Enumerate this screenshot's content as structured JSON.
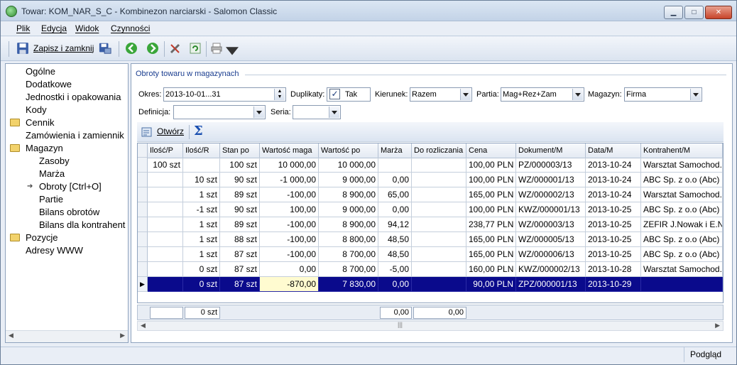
{
  "window": {
    "title": "Towar: KOM_NAR_S_C - Kombinezon narciarski - Salomon Classic"
  },
  "menu": {
    "items": [
      "Plik",
      "Edycja",
      "Widok",
      "Czynności"
    ]
  },
  "toolbar": {
    "save_close_label": "Zapisz i zamknij"
  },
  "sidebar": {
    "items": [
      {
        "label": "Ogólne",
        "level": 0,
        "folder": false
      },
      {
        "label": "Dodatkowe",
        "level": 0,
        "folder": false
      },
      {
        "label": "Jednostki i opakowania",
        "level": 0,
        "folder": false
      },
      {
        "label": "Kody",
        "level": 0,
        "folder": false
      },
      {
        "label": "Cennik",
        "level": 0,
        "folder": true
      },
      {
        "label": "Zamówienia i zamiennik",
        "level": 0,
        "folder": false
      },
      {
        "label": "Magazyn",
        "level": 0,
        "folder": true
      },
      {
        "label": "Zasoby",
        "level": 1,
        "folder": false
      },
      {
        "label": "Marża",
        "level": 1,
        "folder": false
      },
      {
        "label": "Obroty [Ctrl+O]",
        "level": 1,
        "folder": false,
        "active": true
      },
      {
        "label": "Partie",
        "level": 1,
        "folder": false
      },
      {
        "label": "Bilans obrotów",
        "level": 1,
        "folder": false
      },
      {
        "label": "Bilans dla kontrahent",
        "level": 1,
        "folder": false
      },
      {
        "label": "Pozycje",
        "level": 0,
        "folder": true
      },
      {
        "label": "Adresy WWW",
        "level": 0,
        "folder": false
      }
    ]
  },
  "filters": {
    "group_title": "Obroty towaru w magazynach",
    "okres_label": "Okres:",
    "okres_value": "2013-10-01...31",
    "duplikaty_label": "Duplikaty:",
    "duplikaty_value": "Tak",
    "kierunek_label": "Kierunek:",
    "kierunek_value": "Razem",
    "partia_label": "Partia:",
    "partia_value": "Mag+Rez+Zam",
    "magazyn_label": "Magazyn:",
    "magazyn_value": "Firma",
    "definicja_label": "Definicja:",
    "definicja_value": "",
    "seria_label": "Seria:",
    "seria_value": ""
  },
  "grid": {
    "open_label": "Otwórz",
    "columns": [
      "Ilość/P",
      "Ilość/R",
      "Stan po",
      "Wartość maga",
      "Wartość po",
      "Marża",
      "Do rozliczania",
      "Cena",
      "Dokument/M",
      "Data/M",
      "Kontrahent/M"
    ],
    "rows": [
      [
        "100 szt",
        "",
        "100 szt",
        "10 000,00",
        "10 000,00",
        "",
        "",
        "100,00 PLN",
        "PZ/000003/13",
        "2013-10-24",
        "Warsztat Samochod."
      ],
      [
        "",
        "10 szt",
        "90 szt",
        "-1 000,00",
        "9 000,00",
        "0,00",
        "",
        "100,00 PLN",
        "WZ/000001/13",
        "2013-10-24",
        "ABC Sp. z o.o (Abc)"
      ],
      [
        "",
        "1 szt",
        "89 szt",
        "-100,00",
        "8 900,00",
        "65,00",
        "",
        "165,00 PLN",
        "WZ/000002/13",
        "2013-10-24",
        "Warsztat Samochod."
      ],
      [
        "",
        "-1 szt",
        "90 szt",
        "100,00",
        "9 000,00",
        "0,00",
        "",
        "100,00 PLN",
        "KWZ/000001/13",
        "2013-10-25",
        "ABC Sp. z o.o (Abc)"
      ],
      [
        "",
        "1 szt",
        "89 szt",
        "-100,00",
        "8 900,00",
        "94,12",
        "",
        "238,77 PLN",
        "WZ/000003/13",
        "2013-10-25",
        "ZEFIR J.Nowak i E.N"
      ],
      [
        "",
        "1 szt",
        "88 szt",
        "-100,00",
        "8 800,00",
        "48,50",
        "",
        "165,00 PLN",
        "WZ/000005/13",
        "2013-10-25",
        "ABC Sp. z o.o (Abc)"
      ],
      [
        "",
        "1 szt",
        "87 szt",
        "-100,00",
        "8 700,00",
        "48,50",
        "",
        "165,00 PLN",
        "WZ/000006/13",
        "2013-10-25",
        "ABC Sp. z o.o (Abc)"
      ],
      [
        "",
        "0 szt",
        "87 szt",
        "0,00",
        "8 700,00",
        "-5,00",
        "",
        "160,00 PLN",
        "KWZ/000002/13",
        "2013-10-28",
        "Warsztat Samochod."
      ],
      [
        "",
        "0 szt",
        "87 szt",
        "-870,00",
        "7 830,00",
        "0,00",
        "",
        "90,00 PLN",
        "ZPZ/000001/13",
        "2013-10-29",
        ""
      ]
    ],
    "selected_row": 8,
    "footer": {
      "ilosc_p": "",
      "ilosc_r": "0 szt",
      "marza": "0,00",
      "do_rozliczania": "0,00"
    }
  },
  "status": {
    "mode": "Podgląd"
  },
  "colors": {
    "selection": "#0a0a8c",
    "accent": "#1a3d8f"
  }
}
